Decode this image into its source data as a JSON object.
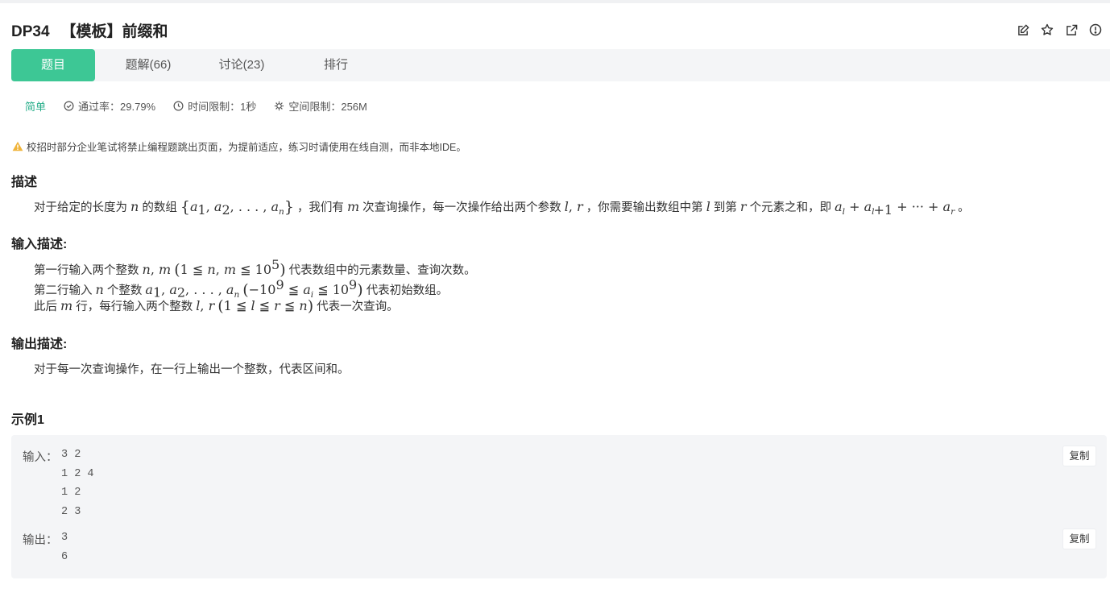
{
  "problem": {
    "id": "DP34",
    "title": "【模板】前缀和"
  },
  "icons": [
    "edit-icon",
    "star-icon",
    "open-external-icon",
    "report-icon"
  ],
  "tabs": [
    {
      "label": "题目",
      "active": true
    },
    {
      "label": "题解(66)",
      "active": false
    },
    {
      "label": "讨论(23)",
      "active": false
    },
    {
      "label": "排行",
      "active": false
    }
  ],
  "meta": {
    "difficulty": "简单",
    "pass_rate": "通过率：29.79%",
    "time_limit": "时间限制：1秒",
    "space_limit": "空间限制：256M"
  },
  "warning": "校招时部分企业笔试将禁止编程题跳出页面，为提前适应，练习时请使用在线自测，而非本地IDE。",
  "description": {
    "heading": "描述",
    "t1": "对于给定的长度为",
    "t2": "的数组",
    "t3": "，我们有",
    "t4": "次查询操作，每一次操作给出两个参数",
    "t5": "，你需要输出数组中第",
    "t6": "到第",
    "t7": "个元素之和，即",
    "t8": "。"
  },
  "input_desc": {
    "heading": "输入描述:",
    "l1a": "第一行输入两个整数",
    "l1b": "代表数组中的元素数量、查询次数。",
    "l2a": "第二行输入",
    "l2b": "个整数",
    "l2c": "代表初始数组。",
    "l3a": "此后",
    "l3b": "行，每行输入两个整数",
    "l3c": "代表一次查询。"
  },
  "output_desc": {
    "heading": "输出描述:",
    "text": "对于每一次查询操作，在一行上输出一个整数，代表区间和。"
  },
  "example": {
    "heading": "示例1",
    "input_label": "输入：",
    "input": "3 2\n1 2 4\n1 2\n2 3",
    "output_label": "输出：",
    "output": "3\n6",
    "copy_label": "复制"
  },
  "colors": {
    "accent": "#3dc795",
    "easy": "#27ae8a",
    "warning": "#f0b43a"
  }
}
